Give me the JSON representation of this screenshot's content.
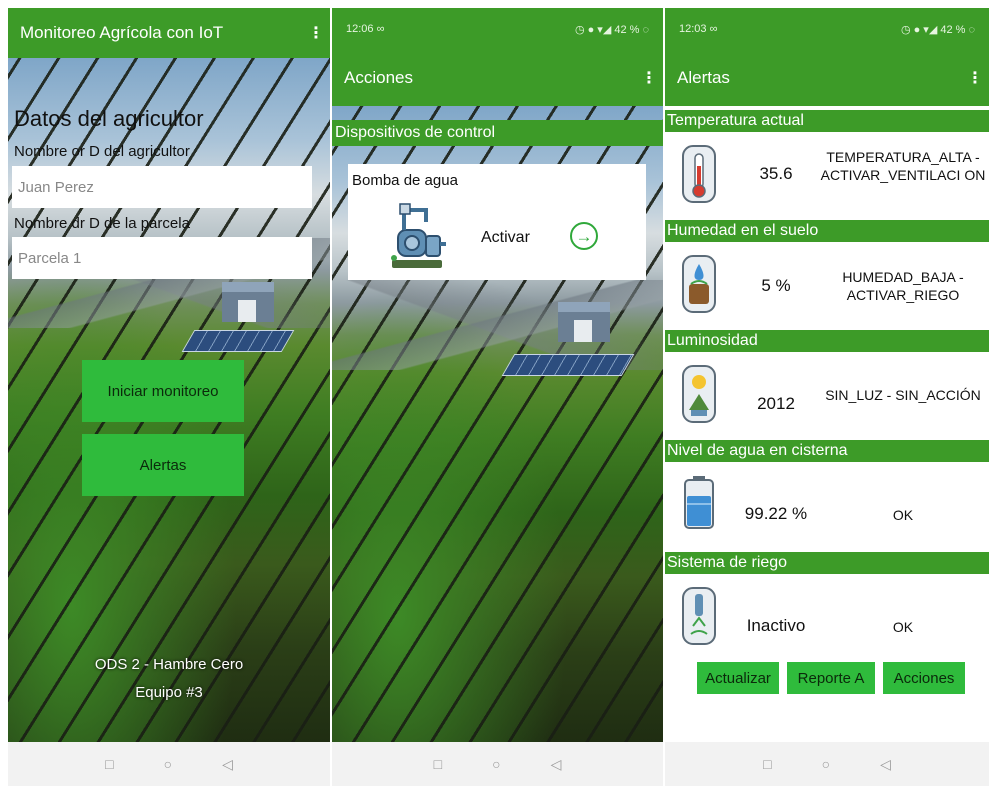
{
  "screen1": {
    "appbar_title": "Monitoreo Agrícola con IoT",
    "menu_glyph": "⋮",
    "form_title": "Datos del agricultor",
    "farmer_label": "Nombre or D del agricultor",
    "farmer_value": "Juan Perez",
    "parcel_label": "Nombre dr D de la parcela",
    "parcel_value": "Parcela 1",
    "start_button": "Iniciar monitoreo",
    "alerts_button": "Alertas",
    "footer_line1": "ODS 2 - Hambre Cero",
    "footer_line2": "Equipo #3"
  },
  "screen2": {
    "status_time": "12:06 ∞",
    "status_right": "◷ ● ▾◢ 42 % ◌",
    "appbar_title": "Acciones",
    "menu_glyph": "⋮",
    "section_title": "Dispositivos de control",
    "device_name": "Bomba de agua",
    "device_action": "Activar",
    "device_arrow": "→"
  },
  "screen3": {
    "status_time": "12:03 ∞",
    "status_right": "◷ ● ▾◢ 42 % ◌",
    "appbar_title": "Alertas",
    "menu_glyph": "⋮",
    "alerts": [
      {
        "title": "Temperatura actual",
        "value": "35.6",
        "status": "TEMPERATURA_ALTA - ACTIVAR_VENTILACI ON",
        "icon": "thermometer-icon"
      },
      {
        "title": "Humedad en el suelo",
        "value": "5 %",
        "status": "HUMEDAD_BAJA - ACTIVAR_RIEGO",
        "icon": "soil-moisture-icon"
      },
      {
        "title": "Luminosidad",
        "value": "2012",
        "status": "SIN_LUZ - SIN_ACCIÓN",
        "icon": "light-sensor-icon"
      },
      {
        "title": "Nivel de agua en cisterna",
        "value": "99.22 %",
        "status": "OK",
        "icon": "water-tank-icon"
      },
      {
        "title": "Sistema de riego",
        "value": "Inactivo",
        "status": "OK",
        "icon": "irrigation-icon"
      }
    ],
    "buttons": {
      "refresh": "Actualizar",
      "report": "Reporte A",
      "actions": "Acciones"
    }
  },
  "navbar": {
    "recent_glyph": "□",
    "home_glyph": "○",
    "back_glyph": "◁"
  },
  "colors": {
    "appbar_green": "#3d9b28",
    "button_green": "#2fbb3c",
    "accent_green": "#2fa83a"
  }
}
